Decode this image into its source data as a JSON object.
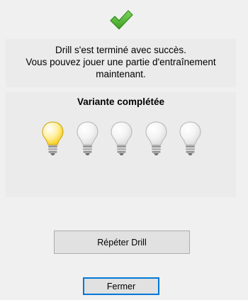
{
  "status": {
    "icon": "checkmark-icon",
    "line1": "Drill s'est terminé avec succès.",
    "line2": "Vous pouvez jouer une partie d'entraînement",
    "line3": "maintenant."
  },
  "variant": {
    "title": "Variante complétée",
    "lit_count": 1,
    "total_count": 5,
    "lit_color": "#f5c400",
    "unlit_color": "#d8d8d8"
  },
  "buttons": {
    "repeat_label": "Répéter Drill",
    "close_label": "Fermer"
  },
  "colors": {
    "check": "#55b936",
    "focus_border": "#0078d7"
  }
}
